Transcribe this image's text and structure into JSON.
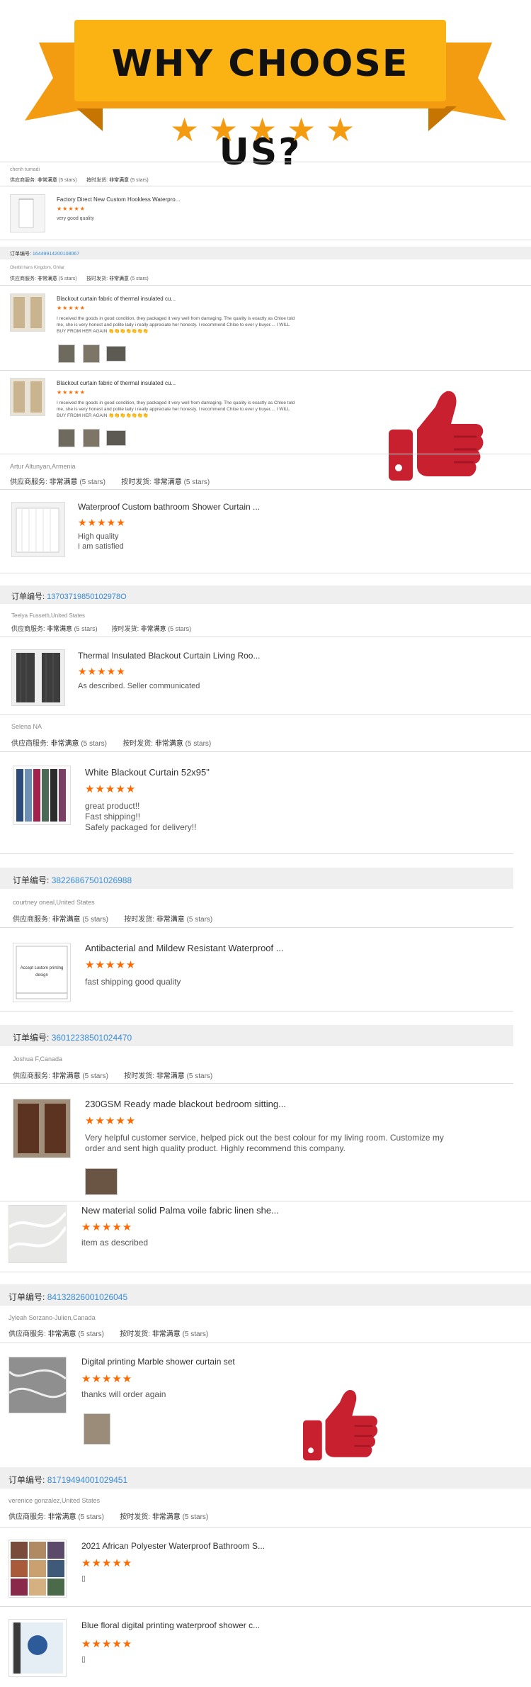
{
  "banner": {
    "title": "WHY CHOOSE US?",
    "stars": [
      "★",
      "★",
      "★",
      "★",
      "★"
    ]
  },
  "labels": {
    "order_prefix": "订单编号:",
    "service": "供应商服务:",
    "delivery": "按时发货:",
    "very_satisfied": "非常满意",
    "five_stars": "(5 stars)",
    "rating_stars": "★★★★★"
  },
  "reviews": [
    {
      "buyer": "chenh tumadi",
      "title": "Factory Direct New Custom Hookless Waterpro...",
      "text": "very good quality"
    },
    {
      "order": "16449914200108067",
      "buyer": "Oterbil hans Kingdom, Ghilar",
      "title": "Blackout curtain fabric of thermal insulated cu...",
      "text": "I received the goods in good condition, they packaged it very well from damaging. The quality is exactly as Chloe told me, she is very honest and polite lady i really appreciate her honesty. I recommend Chloe to ever y buyer.... I WILL BUY FROM HER AGAIN 👏👏👏👏👏👏👏"
    },
    {
      "title": "Blackout curtain fabric of thermal insulated cu...",
      "text": "I received the goods in good condition, they packaged it very well from damaging. The quality is exactly as Chloe told me, she is very honest and polite lady i really appreciate her honesty. I recommend Chloe to ever y buyer.... I WILL BUY FROM HER AGAIN 👏👏👏👏👏👏👏"
    },
    {
      "buyer": "Artur Altunyan,Armenia",
      "title": "Waterproof Custom bathroom Shower Curtain ...",
      "text1": "High quality",
      "text2": "I am satisfied"
    },
    {
      "order": "13703719850102978O",
      "buyer": "Teelya Fusseth,United States",
      "title": "Thermal Insulated Blackout Curtain Living Roo...",
      "text": "As described. Seller communicated"
    },
    {
      "buyer": "Selena NA",
      "title": "White Blackout Curtain 52x95\"",
      "text1": "great product!!",
      "text2": "Fast shipping!!",
      "text3": "Safely packaged for delivery!!"
    },
    {
      "order": "38226867501026988",
      "buyer": "courtney oneal,United States",
      "title": "Antibacterial and Mildew Resistant Waterproof ...",
      "thumb_text": "Accept custom printing design",
      "text": "fast shipping good quality"
    },
    {
      "order": "36012238501024470",
      "buyer": "Joshua F,Canada",
      "title": "230GSM Ready made blackout bedroom sitting...",
      "text": "Very helpful customer service, helped pick out the best colour for my living room. Customize my order and sent high quality product. Highly recommend this company."
    },
    {
      "title": "New material solid Palma voile fabric linen she...",
      "text": "item as described"
    },
    {
      "order": "84132826001026045",
      "buyer": "Jyleah Sorzano-Julien,Canada",
      "title": "Digital printing Marble shower curtain set",
      "text": "thanks will order again"
    },
    {
      "order": "81719494001029451",
      "buyer": "verenice gonzalez,United States",
      "title": "2021 African Polyester Waterproof Bathroom S...",
      "text": "▯"
    },
    {
      "title": "Blue floral digital printing waterproof shower c...",
      "text": "▯"
    }
  ],
  "colors": {
    "banner_yellow": "#fbb314",
    "ribbon_orange": "#f39c12",
    "star_orange": "#ff6a00",
    "order_blue": "#3a8cd6",
    "thumb_red": "#c8202f"
  },
  "icons": [
    "star-icon",
    "thumbs-up-icon"
  ]
}
